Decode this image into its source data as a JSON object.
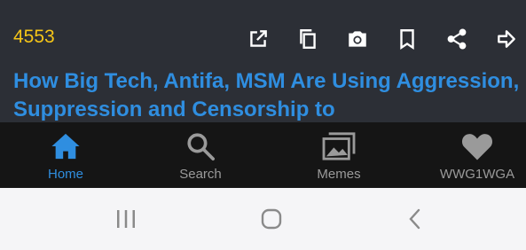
{
  "card": {
    "id": "4553",
    "headline": "How Big Tech, Antifa, MSM Are Using Aggression, Suppression and Censorship to",
    "actions": [
      "open-external-icon",
      "copy-icon",
      "camera-icon",
      "bookmark-icon",
      "share-icon",
      "forward-icon"
    ]
  },
  "nav": {
    "items": [
      {
        "label": "Home",
        "icon": "home-icon",
        "active": true
      },
      {
        "label": "Search",
        "icon": "search-icon",
        "active": false
      },
      {
        "label": "Memes",
        "icon": "images-icon",
        "active": false
      },
      {
        "label": "WWG1WGA",
        "icon": "heart-icon",
        "active": false
      }
    ]
  },
  "system_nav": [
    "recents-icon",
    "home-circle-icon",
    "back-icon"
  ],
  "colors": {
    "card_bg": "#2c2f36",
    "id_color": "#f5c518",
    "accent": "#2f8ee0",
    "nav_bg": "#151515",
    "inactive": "#9a9a9a",
    "system_bar": "#f5f5f7"
  }
}
